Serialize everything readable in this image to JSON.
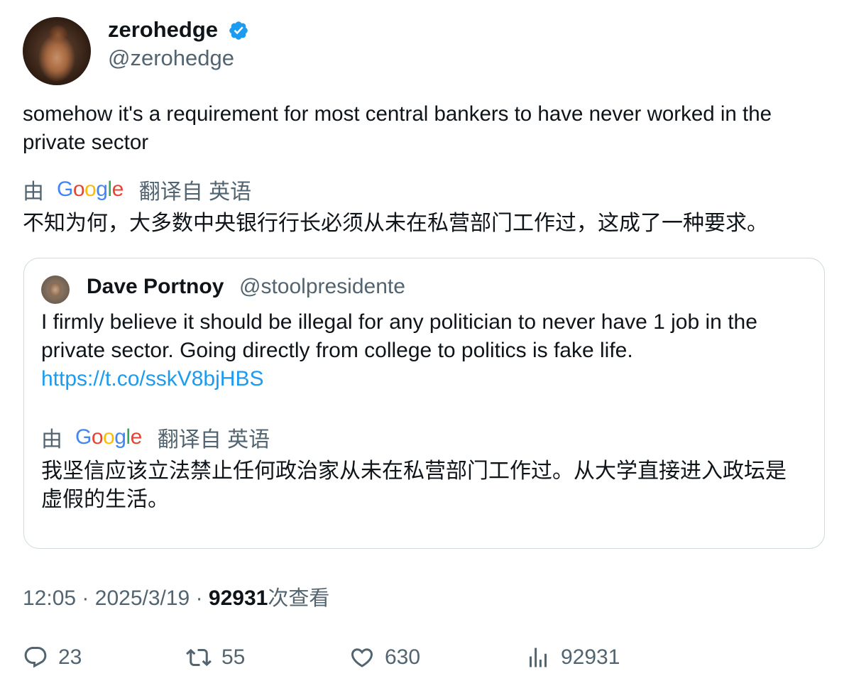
{
  "tweet": {
    "author": {
      "name": "zerohedge",
      "handle": "@zerohedge",
      "verified": true
    },
    "text": "somehow it's a requirement for most central bankers to have never worked in the private sector",
    "translation": {
      "by_label": "由",
      "google_letters": [
        "G",
        "o",
        "o",
        "g",
        "l",
        "e"
      ],
      "from_label": "翻译自 英语",
      "text": "不知为何，大多数中央银行行长必须从未在私营部门工作过，这成了一种要求。"
    },
    "quote": {
      "name": "Dave Portnoy",
      "handle": "@stoolpresidente",
      "text": "I firmly believe it should be illegal for any politician to never have 1 job in the private sector.   Going directly from college to politics is fake life.",
      "link": "https://t.co/sskV8bjHBS",
      "translation": {
        "by_label": "由",
        "google_letters": [
          "G",
          "o",
          "o",
          "g",
          "l",
          "e"
        ],
        "from_label": "翻译自 英语",
        "text": "我坚信应该立法禁止任何政治家从未在私营部门工作过。从大学直接进入政坛是虚假的生活。"
      }
    },
    "meta": {
      "time": "12:05",
      "date": "2025/3/19",
      "separator": "·",
      "views_count": "92931",
      "views_label": "次查看"
    },
    "actions": {
      "replies": "23",
      "retweets": "55",
      "likes": "630",
      "views": "92931"
    }
  },
  "colors": {
    "text_primary": "#0f1419",
    "text_secondary": "#536471",
    "link": "#1d9bf0",
    "verified": "#1d9bf0",
    "border": "#cfd9de"
  },
  "icons": [
    "verified-badge-icon",
    "reply-icon",
    "retweet-icon",
    "like-icon",
    "views-icon"
  ]
}
